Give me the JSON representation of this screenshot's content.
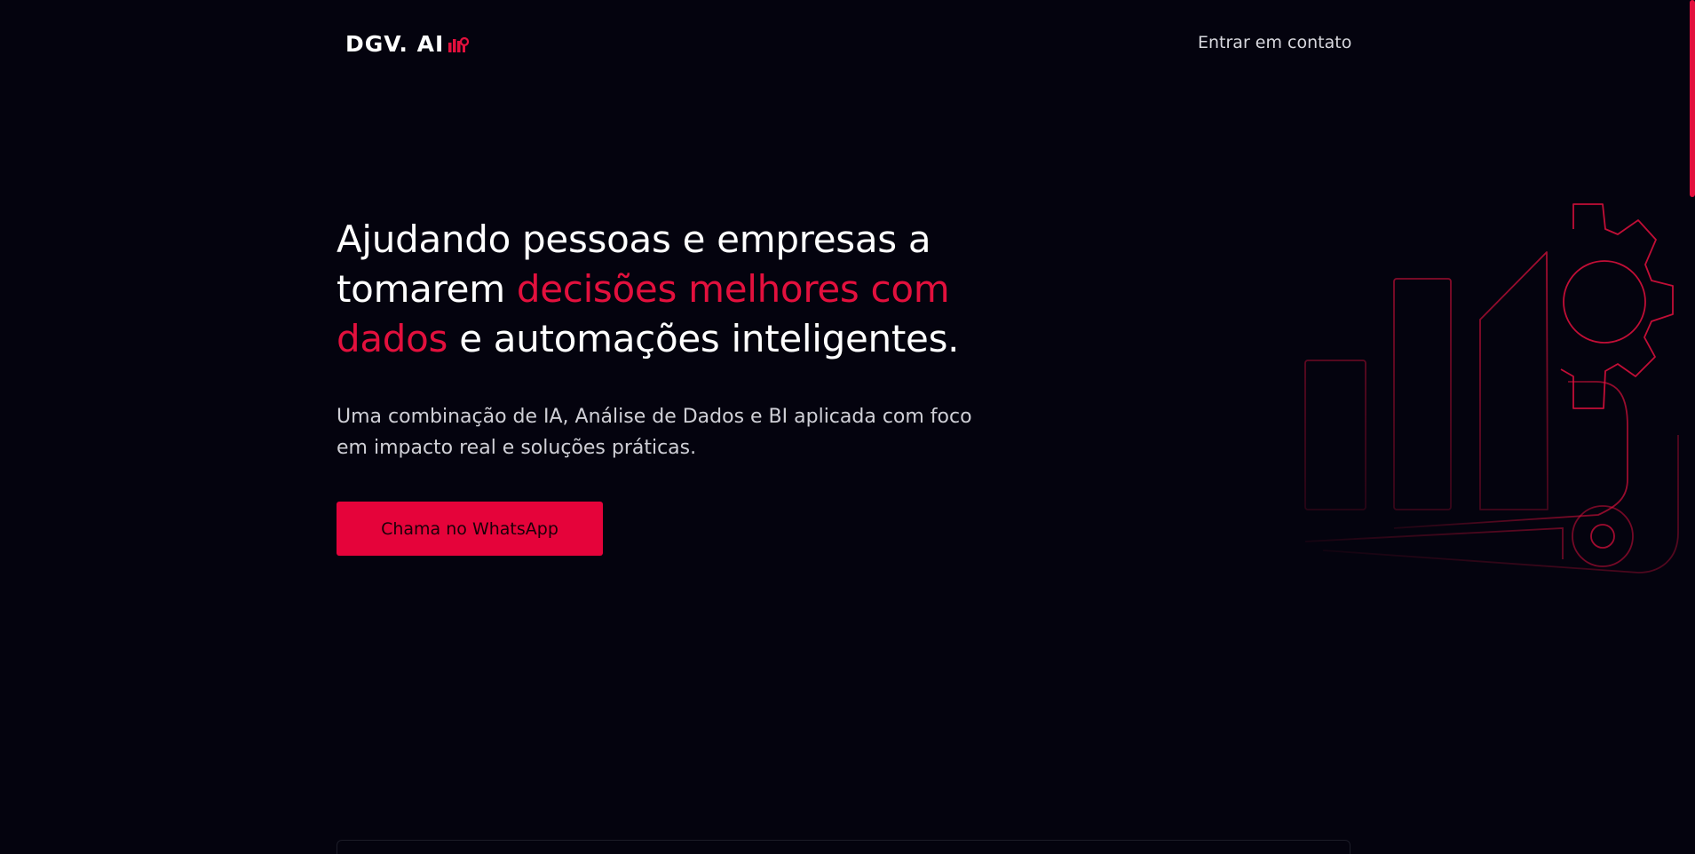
{
  "header": {
    "logo_text": "DGV. AI",
    "logo_icon": "chart-gear-icon",
    "contact_link": "Entrar em contato"
  },
  "hero": {
    "title_part1": "Ajudando pessoas e empresas a tomarem ",
    "title_accent": "decisões melhores com dados",
    "title_part2": " e automações inteligentes.",
    "subtitle": "Uma combinação de IA, Análise de Dados e BI aplicada com foco em impacto real e soluções práticas.",
    "cta_label": "Chama no WhatsApp",
    "illustration": "bar-chart-gear-icon"
  },
  "colors": {
    "background": "#04030e",
    "accent": "#e3103d",
    "text": "#ffffff",
    "muted_text": "#cfcfd6"
  }
}
